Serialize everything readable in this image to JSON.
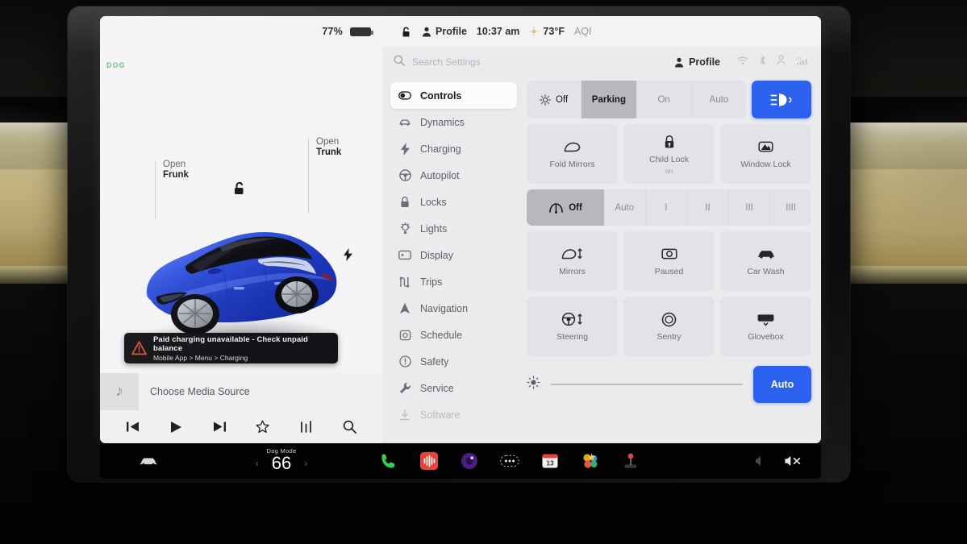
{
  "statusbar": {
    "battery_percent": "77%",
    "lock_icon": "unlocked-lock-icon",
    "profile_label": "Profile",
    "time": "10:37 am",
    "temperature": "73°F",
    "aqi_label": "AQI"
  },
  "car_panel": {
    "drive_badge": "DOG",
    "open_frunk_line1": "Open",
    "open_frunk_line2": "Frunk",
    "open_trunk_line1": "Open",
    "open_trunk_line2": "Trunk",
    "toast": {
      "title": "Paid charging unavailable - Check unpaid balance",
      "subtitle": "Mobile App > Menu > Charging"
    },
    "media": {
      "source_label": "Choose Media Source",
      "controls": [
        "previous",
        "play",
        "next",
        "favorite",
        "equalizer",
        "search"
      ]
    },
    "car_color": "#2b4fd6"
  },
  "settings": {
    "search_placeholder": "Search Settings",
    "profile_label": "Profile",
    "nav": [
      {
        "label": "Controls",
        "icon": "toggle-icon",
        "active": true
      },
      {
        "label": "Dynamics",
        "icon": "car-icon",
        "active": false
      },
      {
        "label": "Charging",
        "icon": "bolt-icon",
        "active": false
      },
      {
        "label": "Autopilot",
        "icon": "steering-icon",
        "active": false
      },
      {
        "label": "Locks",
        "icon": "lock-icon",
        "active": false
      },
      {
        "label": "Lights",
        "icon": "bulb-icon",
        "active": false
      },
      {
        "label": "Display",
        "icon": "display-icon",
        "active": false
      },
      {
        "label": "Trips",
        "icon": "trips-icon",
        "active": false
      },
      {
        "label": "Navigation",
        "icon": "navigation-icon",
        "active": false
      },
      {
        "label": "Schedule",
        "icon": "clock-icon",
        "active": false
      },
      {
        "label": "Safety",
        "icon": "info-icon",
        "active": false
      },
      {
        "label": "Service",
        "icon": "wrench-icon",
        "active": false
      },
      {
        "label": "Software",
        "icon": "download-icon",
        "active": false
      }
    ],
    "lights_row": {
      "off": "Off",
      "parking": "Parking",
      "on": "On",
      "auto": "Auto",
      "selected": "Parking",
      "highbeam_icon": "headlight-icon"
    },
    "mirror_row": [
      {
        "label": "Fold Mirrors",
        "sub": "",
        "icon": "mirror-icon"
      },
      {
        "label": "Child Lock",
        "sub": "on",
        "icon": "child-lock-icon"
      },
      {
        "label": "Window Lock",
        "sub": "",
        "icon": "window-lock-icon"
      }
    ],
    "wipers": {
      "off": "Off",
      "auto": "Auto",
      "steps": [
        "I",
        "II",
        "III",
        "IIII"
      ],
      "selected": "Off",
      "icon": "wiper-icon"
    },
    "action_row_1": [
      {
        "label": "Mirrors",
        "icon": "mirror-adjust-icon"
      },
      {
        "label": "Paused",
        "icon": "camera-icon"
      },
      {
        "label": "Car Wash",
        "icon": "car-wash-icon"
      }
    ],
    "action_row_2": [
      {
        "label": "Steering",
        "icon": "steering-adjust-icon"
      },
      {
        "label": "Sentry",
        "icon": "sentry-icon"
      },
      {
        "label": "Glovebox",
        "icon": "glovebox-icon"
      }
    ],
    "brightness": {
      "icon": "brightness-icon",
      "auto_label": "Auto",
      "value_percent": 0
    },
    "accent_color": "#2d62f0"
  },
  "taskbar": {
    "car_icon": "car-front-icon",
    "dog_mode_label": "Dog Mode",
    "temperature": "66",
    "left_arrow": "‹",
    "right_arrow": "›",
    "apps": [
      {
        "name": "phone-icon",
        "color": "#2ed154"
      },
      {
        "name": "audio-icon",
        "color": "#e8433a"
      },
      {
        "name": "browser-icon",
        "color": "#5b2a8c"
      },
      {
        "name": "more-icon",
        "color": "#e8e8ec"
      },
      {
        "name": "calendar-icon",
        "color": "#e8433a",
        "badge": "13"
      },
      {
        "name": "apps-grid-icon",
        "color": "#f0a030"
      },
      {
        "name": "arcade-icon",
        "color": "#d64545"
      }
    ],
    "volume_icon": "mute-icon"
  }
}
